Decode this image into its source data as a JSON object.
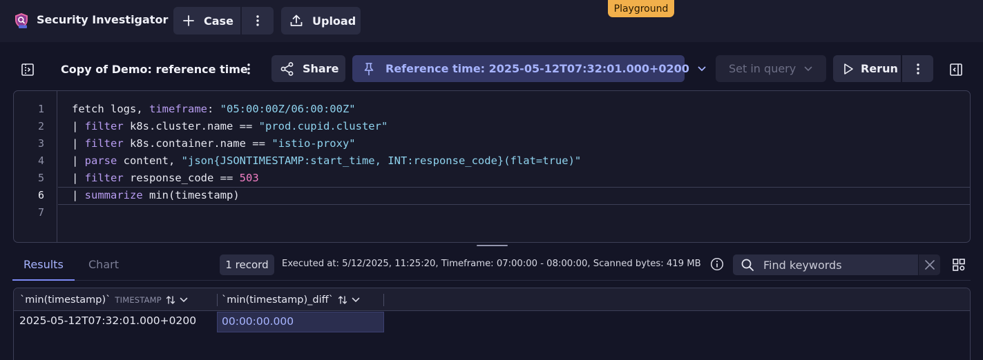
{
  "app": {
    "title": "Security Investigator",
    "logo_icon": "shield-search-icon",
    "environment_badge": "Playground"
  },
  "topbar": {
    "case_label": "Case",
    "case_icon": "plus-icon",
    "more_icon": "more-vertical-icon",
    "upload_label": "Upload",
    "upload_icon": "upload-icon"
  },
  "toolbar": {
    "document_title": "Copy of Demo: reference time",
    "share_label": "Share",
    "share_icon": "share-icon",
    "reference_time_label": "Reference time: 2025-05-12T07:32:01.000+0200",
    "reference_time_icon": "pin-icon",
    "set_in_query_label": "Set in query",
    "rerun_label": "Rerun",
    "rerun_icon": "play-icon"
  },
  "editor": {
    "line_numbers": [
      "1",
      "2",
      "3",
      "4",
      "5",
      "6",
      "7"
    ],
    "active_line": "6",
    "lines": [
      [
        {
          "t": "fetch",
          "c": "plain"
        },
        {
          "t": " logs, ",
          "c": "plain"
        },
        {
          "t": "timeframe",
          "c": "kw"
        },
        {
          "t": ": ",
          "c": "plain"
        },
        {
          "t": "\"05:00:00Z/06:00:00Z\"",
          "c": "str"
        }
      ],
      [
        {
          "t": "| ",
          "c": "plain"
        },
        {
          "t": "filter",
          "c": "kw"
        },
        {
          "t": " k8s.cluster.name == ",
          "c": "plain"
        },
        {
          "t": "\"prod.cupid.cluster\"",
          "c": "str"
        }
      ],
      [
        {
          "t": "| ",
          "c": "plain"
        },
        {
          "t": "filter",
          "c": "kw"
        },
        {
          "t": " k8s.container.name == ",
          "c": "plain"
        },
        {
          "t": "\"istio-proxy\"",
          "c": "str"
        }
      ],
      [
        {
          "t": "| ",
          "c": "plain"
        },
        {
          "t": "parse",
          "c": "kw"
        },
        {
          "t": " content, ",
          "c": "plain"
        },
        {
          "t": "\"json{JSONTIMESTAMP:start_time, INT:response_code}(flat=true)\"",
          "c": "str"
        }
      ],
      [
        {
          "t": "| ",
          "c": "plain"
        },
        {
          "t": "filter",
          "c": "kw"
        },
        {
          "t": " response_code == ",
          "c": "plain"
        },
        {
          "t": "503",
          "c": "num"
        }
      ],
      [
        {
          "t": "| ",
          "c": "plain"
        },
        {
          "t": "summarize",
          "c": "kw"
        },
        {
          "t": " min(timestamp)",
          "c": "plain"
        }
      ],
      []
    ]
  },
  "results": {
    "tabs": [
      {
        "label": "Results",
        "selected": true
      },
      {
        "label": "Chart",
        "selected": false
      }
    ],
    "record_count": "1 record",
    "execution_info": "Executed at: 5/12/2025, 11:25:20, Timeframe: 07:00:00 - 08:00:00, Scanned bytes: 419 MB",
    "search_placeholder": "Find keywords",
    "columns": [
      {
        "name": "`min(timestamp)`",
        "type": "TIMESTAMP"
      },
      {
        "name": "`min(timestamp)_diff`",
        "type": ""
      }
    ],
    "rows": [
      [
        "2025-05-12T07:32:01.000+0200",
        "00:00:00.000"
      ]
    ]
  },
  "colors": {
    "background": "#141526",
    "accent": "#a7b4ff",
    "keyword": "#b79cf0",
    "string": "#8fd3ee",
    "number": "#f27fc4",
    "badge": "#f2b04b"
  }
}
